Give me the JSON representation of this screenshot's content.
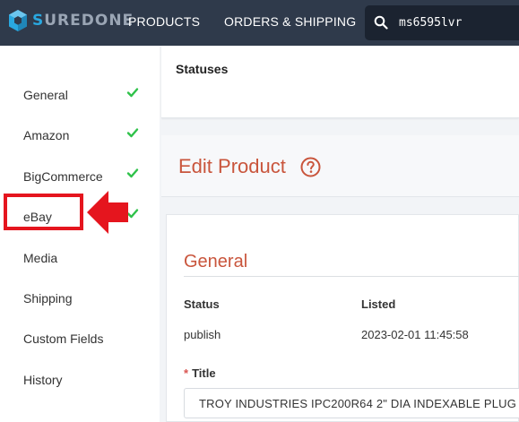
{
  "brand": {
    "name_prefix": "S",
    "name_rest": "UREDONE",
    "logo_icon": "suredone-cube-icon"
  },
  "nav": {
    "products": "PRODUCTS",
    "orders_shipping": "ORDERS & SHIPPING",
    "search_value": "ms6595lvr"
  },
  "sidebar": {
    "items": [
      {
        "label": "General",
        "checked": true
      },
      {
        "label": "Amazon",
        "checked": true
      },
      {
        "label": "BigCommerce",
        "checked": true
      },
      {
        "label": "eBay",
        "checked": true
      },
      {
        "label": "Media",
        "checked": false,
        "highlighted": true
      },
      {
        "label": "Shipping",
        "checked": false
      },
      {
        "label": "Custom Fields",
        "checked": false
      },
      {
        "label": "History",
        "checked": false
      }
    ]
  },
  "statuses": {
    "title": "Statuses"
  },
  "edit": {
    "title": "Edit Product"
  },
  "general": {
    "title": "General",
    "columns": [
      {
        "header": "Status",
        "value": "publish"
      },
      {
        "header": "Listed",
        "value": "2023-02-01 11:45:58"
      }
    ],
    "title_field": {
      "required_mark": "*",
      "label": "Title",
      "value": "TROY INDUSTRIES IPC200R64 2\" DIA INDEXABLE PLUG"
    }
  },
  "colors": {
    "topbar": "#2f3a4b",
    "accent_heading": "#c9553c",
    "check": "#2fc24a",
    "annotation_red": "#e5151e",
    "logo_blue": "#29a8e0"
  }
}
